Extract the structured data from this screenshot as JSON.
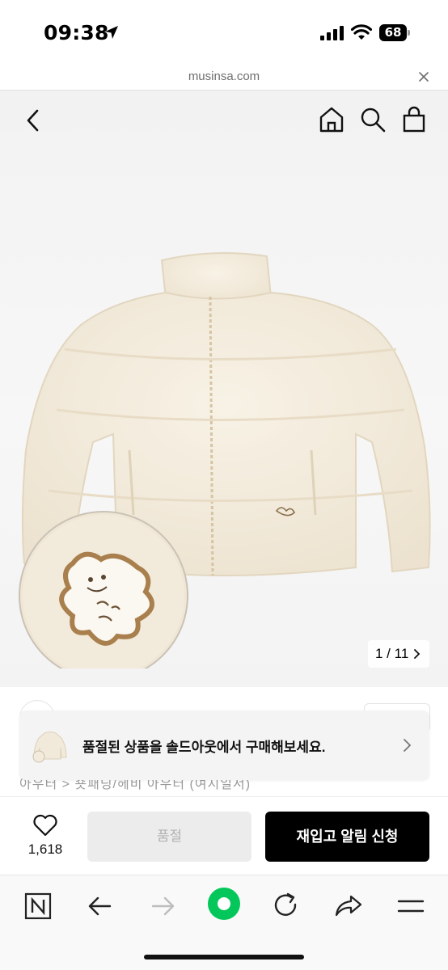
{
  "status_bar": {
    "time": "09:38",
    "battery": "68",
    "icons": [
      "location-arrow-icon",
      "cellular-signal-icon",
      "wifi-icon",
      "battery-icon"
    ]
  },
  "browser": {
    "url": "musinsa.com"
  },
  "header": {
    "icons": [
      "back-chevron-icon",
      "home-icon",
      "search-icon",
      "shopping-bag-icon"
    ]
  },
  "gallery": {
    "counter": "1 / 11"
  },
  "info": {
    "partial_text": "아우터 > 숏패딩/헤비 아우터 (여지일서)"
  },
  "toast": {
    "message": "품절된 상품을 솔드아웃에서 구매해보세요."
  },
  "purchase_bar": {
    "like_count": "1,618",
    "soldout_label": "품절",
    "restock_label": "재입고 알림 신청"
  },
  "toolbar": {
    "icons": [
      "naver-n-icon",
      "back-arrow-icon",
      "forward-arrow-icon",
      "green-circle-icon",
      "reload-icon",
      "share-icon",
      "menu-icon"
    ]
  },
  "colors": {
    "primary_button": "#000000",
    "disabled_button": "#ececec",
    "naver_green": "#03c75a",
    "product_cream": "#f4eddf"
  }
}
